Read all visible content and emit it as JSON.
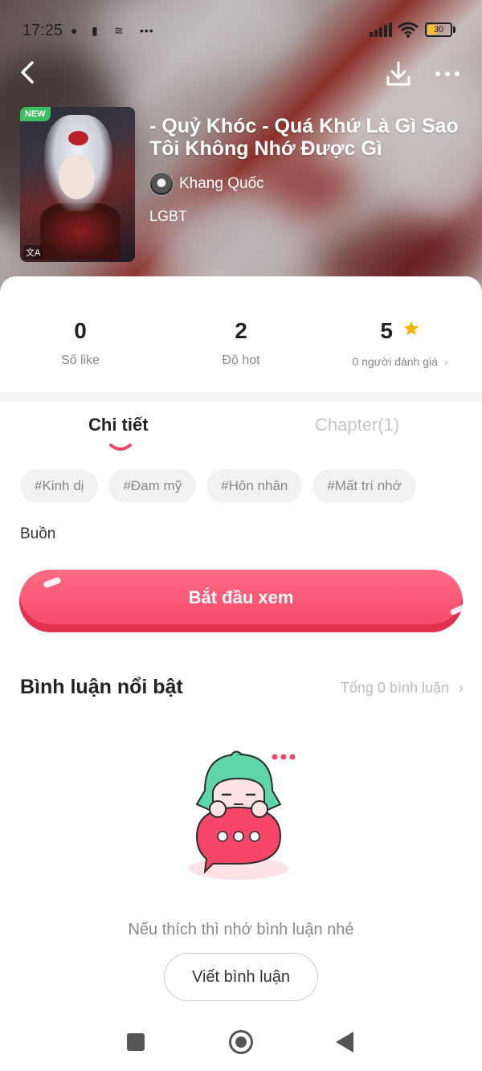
{
  "status_bar": {
    "time": "17:25",
    "battery": "30"
  },
  "book": {
    "badge": "NEW",
    "title": "- Quỷ Khóc - Quá Khứ Là Gì Sao Tôi Không Nhớ Được Gì",
    "author": "Khang Quốc",
    "genre": "LGBT"
  },
  "stats": {
    "likes_value": "0",
    "likes_label": "Số like",
    "hot_value": "2",
    "hot_label": "Độ hot",
    "rating_value": "5",
    "rating_label": "0 người đánh giá"
  },
  "tabs": {
    "details": "Chi tiết",
    "chapters": "Chapter(1)"
  },
  "tags": [
    "#Kinh dị",
    "#Đam mỹ",
    "#Hôn nhân",
    "#Mất trí nhớ"
  ],
  "description": "Buồn",
  "start_button": "Bắt đầu xem",
  "comments": {
    "title": "Bình luận nổi bật",
    "total": "Tổng 0 bình luận",
    "empty_text": "Nếu thích thì nhớ bình luận nhé",
    "write_button": "Viết bình luận"
  },
  "colors": {
    "accent": "#f64668",
    "star": "#f5b800",
    "new_badge": "#3cbf63"
  }
}
